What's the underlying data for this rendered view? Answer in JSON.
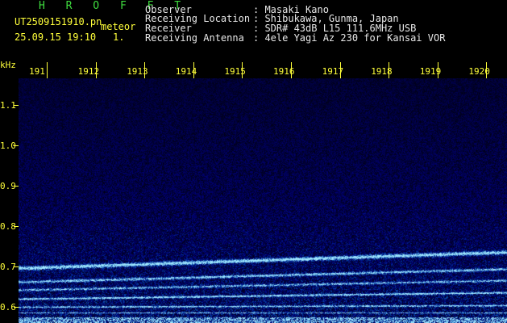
{
  "header": {
    "title": "H R O F F T",
    "filename": "UT2509151910.pn",
    "tag": "meteor",
    "datetime": "25.09.15 19:10",
    "index": "1.",
    "info": [
      {
        "label": "Observer",
        "value": ": Masaki Kano"
      },
      {
        "label": "Receiving Location",
        "value": ": Shibukawa, Gunma, Japan"
      },
      {
        "label": "Receiver",
        "value": ": SDR# 43dB L15 111.6MHz USB"
      },
      {
        "label": "Receiving Antenna",
        "value": ": 4ele Yagi Az 230 for Kansai VOR"
      }
    ]
  },
  "axis": {
    "unit": "kHz",
    "x_ticks": [
      "191",
      "1912",
      "1913",
      "1914",
      "1915",
      "1916",
      "1917",
      "1918",
      "1919",
      "1920"
    ],
    "y_ticks": [
      "1.1",
      "1.0",
      "0.9",
      "0.8",
      "0.7",
      "0.6"
    ]
  },
  "colors": {
    "label": "#ffff3a",
    "title": "#3fdc3f",
    "text": "#e8e8e8",
    "background": "#000000",
    "spectrum": "#0a0a6e"
  }
}
